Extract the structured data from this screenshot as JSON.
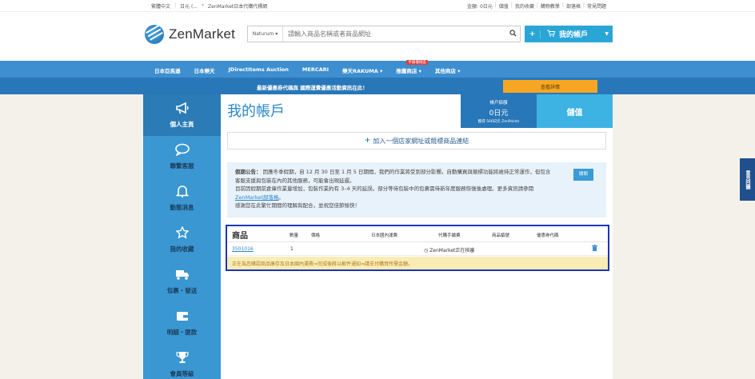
{
  "topbar": {
    "lang": "繁體中文",
    "currency": "日元 (...",
    "tagline": "ZenMarket日本代購代標網",
    "balance": "金額: 0日元",
    "links": [
      "儲值",
      "我的收藏",
      "購物教學",
      "部落格",
      "常見問題"
    ]
  },
  "header": {
    "logo_text": "ZenMarket",
    "search_scope": "Naturum",
    "search_placeholder": "請輸入商品名稱或者商品網址",
    "account_plus": "+",
    "account_label": "我的帳戶"
  },
  "nav": {
    "items": [
      "日本亞馬遜",
      "日本樂天",
      "JDirectItems Auction",
      "MERCARI",
      "樂天RAKUMA",
      "推薦商店",
      "其他商店"
    ],
    "badge": "手錶價格區"
  },
  "promo": {
    "text": "最新優惠券代碼與 國際運費優惠活動資訊在此！",
    "button": "查看詳情"
  },
  "sidebar": {
    "items": [
      {
        "label": "個人主頁",
        "icon": "megaphone-icon",
        "glyph": "📣"
      },
      {
        "label": "聯繫客服",
        "icon": "chat-icon",
        "glyph": "💬"
      },
      {
        "label": "動態消息",
        "icon": "bell-icon",
        "glyph": "🔔"
      },
      {
        "label": "我的收藏",
        "icon": "star-icon",
        "glyph": "☆"
      },
      {
        "label": "包裹・發送",
        "icon": "truck-icon",
        "glyph": "🚚"
      },
      {
        "label": "明細・提款",
        "icon": "wallet-icon",
        "glyph": "👛"
      },
      {
        "label": "會員等級",
        "icon": "trophy-icon",
        "glyph": "🏆"
      }
    ]
  },
  "main": {
    "title": "我的帳戶",
    "balance_title": "帳戶餘額",
    "balance_value": "0日元",
    "balance_sub": "獲得 500日元 ZenPoints",
    "deposit_label": "儲值",
    "add_link": "加入一個店家網址或競標商品連結",
    "notice": {
      "heading": "假期公告：",
      "line1": "因應冬季假期，自 12 月 30 日至 1 月 5 日期間，我們的作業將受到部分影響。自動購買與競標功能將維持正常運作，但包含客服支援與包裝在內的其他服務，可能會出現延遲。",
      "line2": "目前因假期前倉庫作業量增加，包裝作業約有 3–4 天的延誤。部分等待包裝中的包裹需待新年度服務恢復後處理。更多資訊請參閱",
      "link_text": "ZenMarket部落格",
      "line2_end": "。",
      "line3": "感謝您在此繁忙期間的理解與配合，並祝您佳節愉快！",
      "close": "關閉"
    },
    "orders": {
      "title": "商品",
      "headers": [
        "數量",
        "價格",
        "日本國內運費",
        "代購手續費",
        "商品編號",
        "優惠券代碼"
      ],
      "row": {
        "id": "3501016",
        "qty": "1",
        "status": "ZenMarket正在核審"
      },
      "message": "正在為您確認商品庫存及日本國內運費⇒完成後將以郵件通知⇒請支付購買所需金額。"
    }
  },
  "side_tab": "意見回饋"
}
